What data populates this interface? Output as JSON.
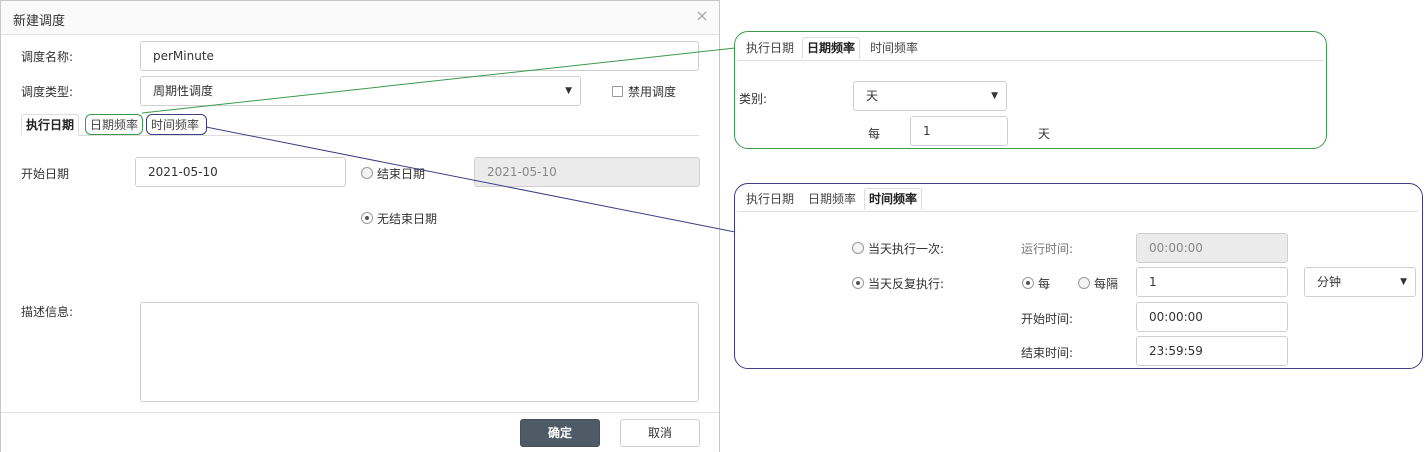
{
  "dialog": {
    "title": "新建调度",
    "close": "×",
    "name_label": "调度名称:",
    "name_value": "perMinute",
    "type_label": "调度类型:",
    "type_value": "周期性调度",
    "disable_label": "禁用调度",
    "tabs": [
      {
        "label": "执行日期",
        "active": true
      },
      {
        "label": "日期频率",
        "active": false
      },
      {
        "label": "时间频率",
        "active": false
      }
    ],
    "start_date_label": "开始日期",
    "start_date_value": "2021-05-10",
    "end_date_label": "结束日期",
    "end_date_value": "2021-05-10",
    "no_end_label": "无结束日期",
    "desc_label": "描述信息:",
    "ok_label": "确定",
    "cancel_label": "取消"
  },
  "date_freq_panel": {
    "tabs": [
      {
        "label": "执行日期",
        "active": false
      },
      {
        "label": "日期频率",
        "active": true
      },
      {
        "label": "时间频率",
        "active": false
      }
    ],
    "category_label": "类别:",
    "category_value": "天",
    "every_label": "每",
    "every_value": "1",
    "unit_label": "天"
  },
  "time_freq_panel": {
    "tabs": [
      {
        "label": "执行日期",
        "active": false
      },
      {
        "label": "日期频率",
        "active": false
      },
      {
        "label": "时间频率",
        "active": true
      }
    ],
    "once_label": "当天执行一次:",
    "run_time_label": "运行时间:",
    "run_time_value": "00:00:00",
    "repeat_label": "当天反复执行:",
    "each_label": "每",
    "interval_label": "每隔",
    "repeat_value": "1",
    "unit_value": "分钟",
    "start_time_label": "开始时间:",
    "start_time_value": "00:00:00",
    "end_time_label": "结束时间:",
    "end_time_value": "23:59:59"
  },
  "colors": {
    "green_callout": "#3c9a4a",
    "blue_callout": "#3a3f86",
    "primary_button": "#4e5a66"
  }
}
